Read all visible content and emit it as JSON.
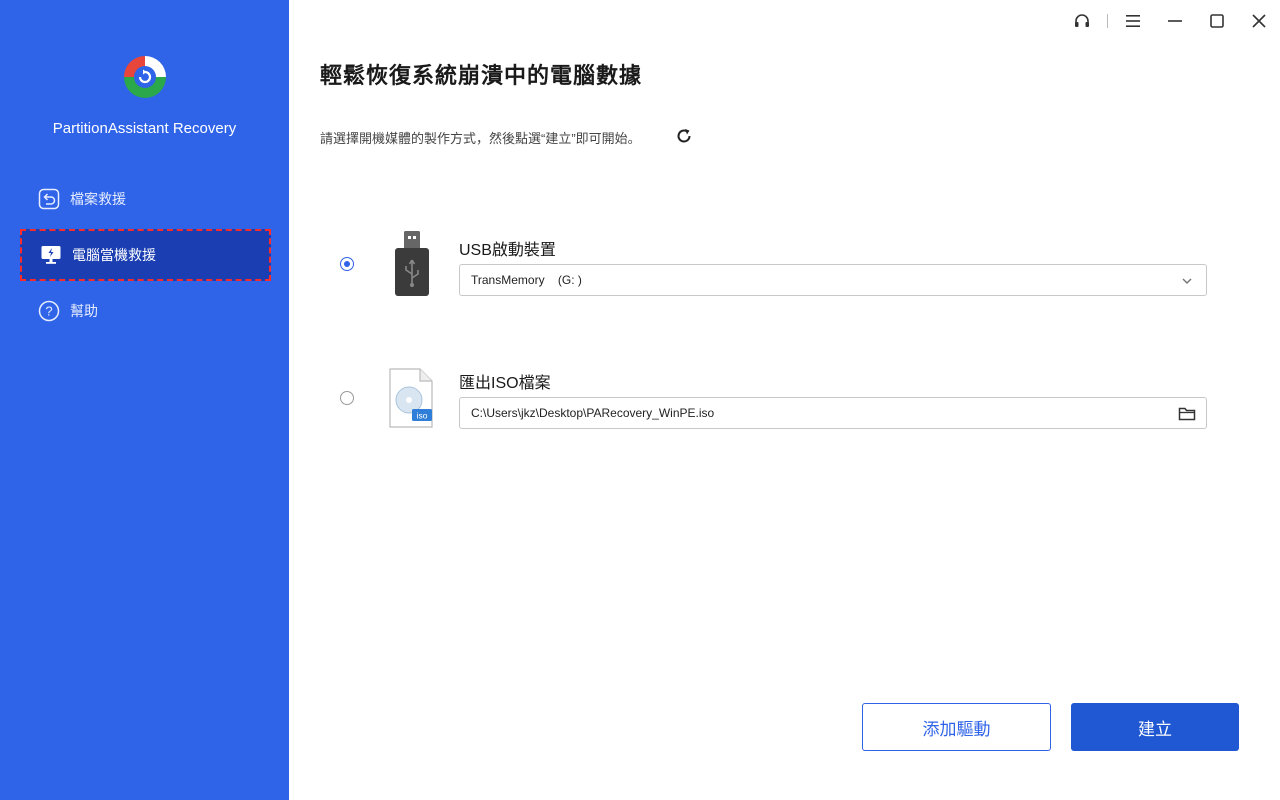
{
  "app": {
    "name": "PartitionAssistant Recovery"
  },
  "sidebar": {
    "items": [
      {
        "label": "檔案救援",
        "icon": "restore-icon",
        "active": false
      },
      {
        "label": "電腦當機救援",
        "icon": "crashed-pc-icon",
        "active": true
      },
      {
        "label": "幫助",
        "icon": "help-icon",
        "active": false
      }
    ]
  },
  "window_controls": [
    "headset-icon",
    "menu-icon",
    "minimize-icon",
    "maximize-icon",
    "close-icon"
  ],
  "main": {
    "title": "輕鬆恢復系統崩潰中的電腦數據",
    "subtitle": "請選擇開機媒體的製作方式，然後點選“建立”即可開始。",
    "options": {
      "usb": {
        "label": "USB啟動裝置",
        "value": "TransMemory    (G: )",
        "selected": true
      },
      "iso": {
        "label": "匯出ISO檔案",
        "value": "C:\\Users\\jkz\\Desktop\\PARecovery_WinPE.iso",
        "selected": false,
        "badge": "iso"
      }
    },
    "buttons": {
      "add_driver": "添加驅動",
      "create": "建立"
    }
  },
  "colors": {
    "sidebar_bg": "#2f63e8",
    "active_item_bg": "#1b3fb3",
    "accent": "#1f58d2",
    "highlight_border": "#ff2a2a"
  }
}
